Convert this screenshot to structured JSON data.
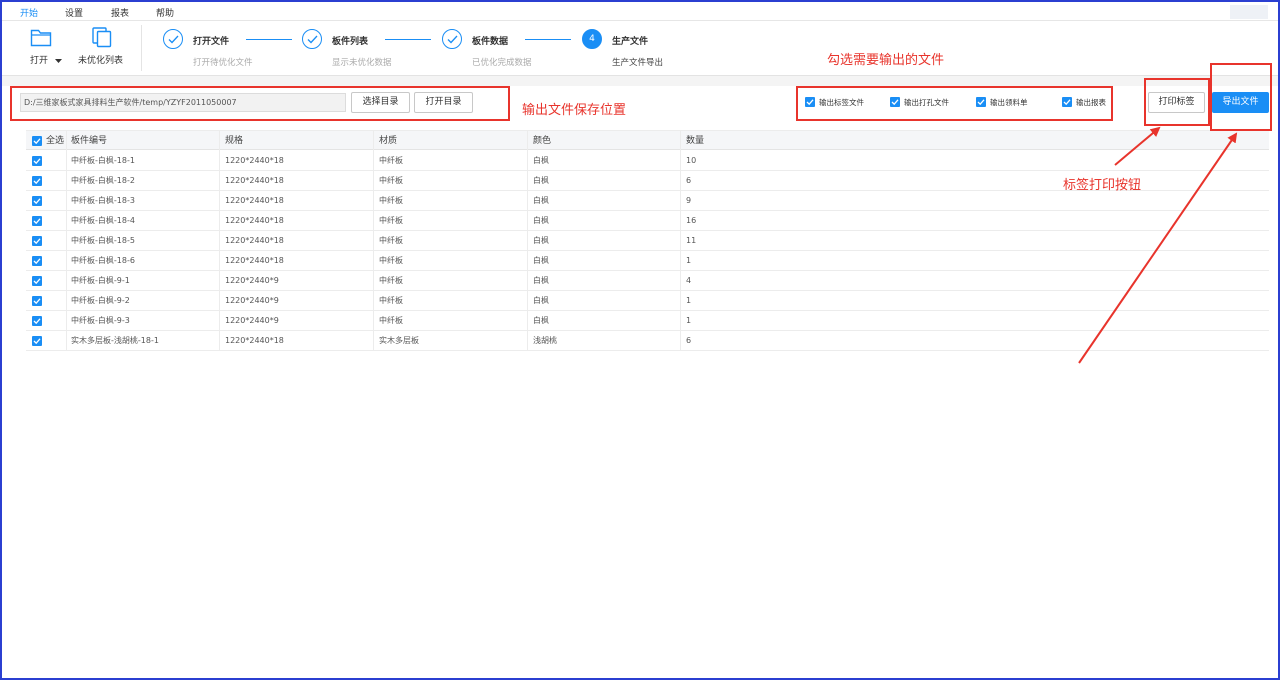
{
  "menu": [
    "开始",
    "设置",
    "报表",
    "帮助"
  ],
  "ribbon": {
    "open_label": "打开",
    "unopt_label": "未优化列表"
  },
  "steps": [
    {
      "num": "1",
      "title": "打开文件",
      "desc": "打开待优化文件",
      "done": true
    },
    {
      "num": "2",
      "title": "板件列表",
      "desc": "显示未优化数据",
      "done": true
    },
    {
      "num": "3",
      "title": "板件数据",
      "desc": "已优化完成数据",
      "done": true
    },
    {
      "num": "4",
      "title": "生产文件",
      "desc": "生产文件导出",
      "done": false
    }
  ],
  "path": {
    "value": "D:/三维家板式家具排料生产软件/temp/YZYF2011050007",
    "select_label": "选择目录",
    "open_label": "打开目录"
  },
  "options": [
    {
      "label": "输出标签文件",
      "checked": true
    },
    {
      "label": "输出打孔文件",
      "checked": true
    },
    {
      "label": "输出领料单",
      "checked": true
    },
    {
      "label": "输出报表",
      "checked": true
    }
  ],
  "print_label": "打印标签",
  "export_label": "导出文件",
  "table": {
    "select_all": "全选",
    "headers": [
      "板件编号",
      "规格",
      "材质",
      "颜色",
      "数量"
    ],
    "rows": [
      [
        "中纤板-白枫-18-1",
        "1220*2440*18",
        "中纤板",
        "白枫",
        "10"
      ],
      [
        "中纤板-白枫-18-2",
        "1220*2440*18",
        "中纤板",
        "白枫",
        "6"
      ],
      [
        "中纤板-白枫-18-3",
        "1220*2440*18",
        "中纤板",
        "白枫",
        "9"
      ],
      [
        "中纤板-白枫-18-4",
        "1220*2440*18",
        "中纤板",
        "白枫",
        "16"
      ],
      [
        "中纤板-白枫-18-5",
        "1220*2440*18",
        "中纤板",
        "白枫",
        "11"
      ],
      [
        "中纤板-白枫-18-6",
        "1220*2440*18",
        "中纤板",
        "白枫",
        "1"
      ],
      [
        "中纤板-白枫-9-1",
        "1220*2440*9",
        "中纤板",
        "白枫",
        "4"
      ],
      [
        "中纤板-白枫-9-2",
        "1220*2440*9",
        "中纤板",
        "白枫",
        "1"
      ],
      [
        "中纤板-白枫-9-3",
        "1220*2440*9",
        "中纤板",
        "白枫",
        "1"
      ],
      [
        "实木多层板-浅胡桃-18-1",
        "1220*2440*18",
        "实木多层板",
        "浅胡桃",
        "6"
      ]
    ]
  },
  "annotations": {
    "output_files": "勾选需要输出的文件",
    "save_location": "输出文件保存位置",
    "print_button": "标签打印按钮"
  },
  "colors": {
    "accent": "#1a8ef5",
    "annotation": "#e8342c",
    "frame": "#2b3fd1"
  }
}
